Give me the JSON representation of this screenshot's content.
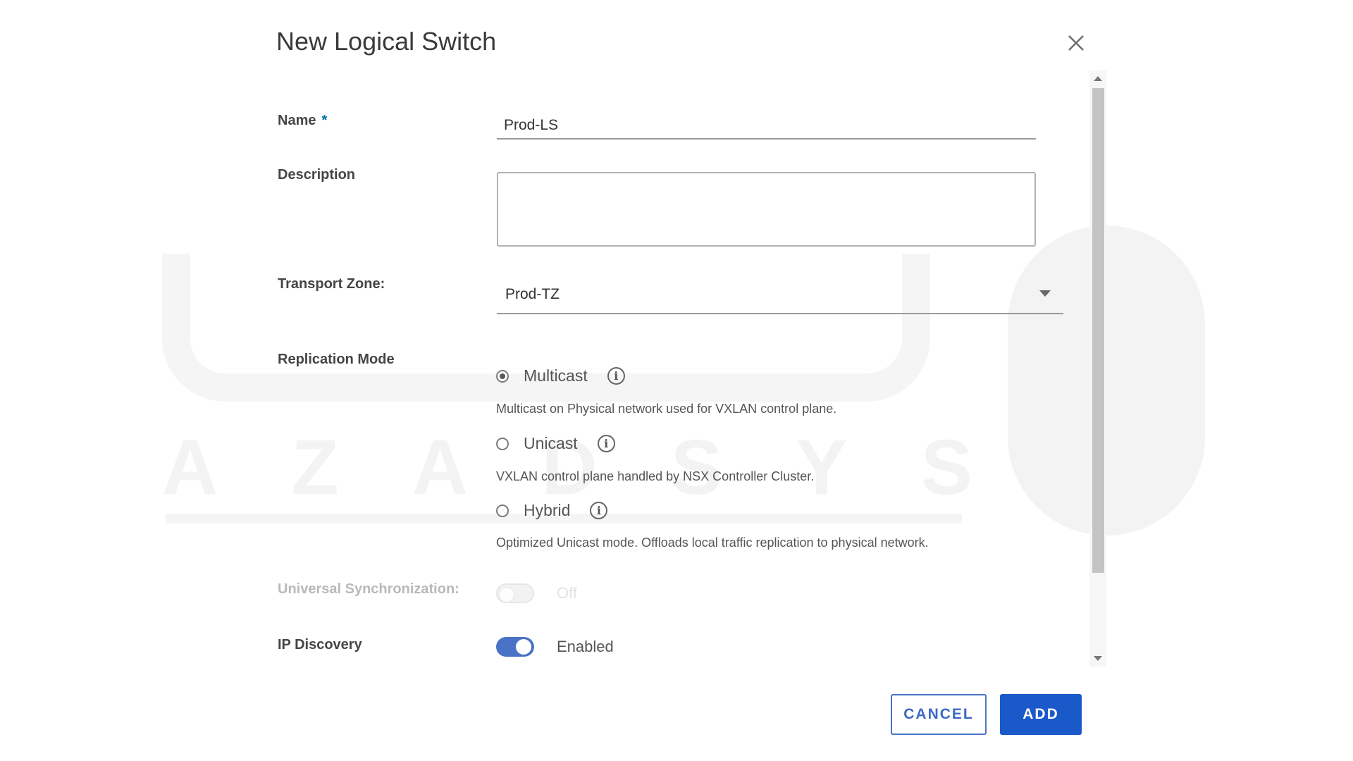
{
  "dialog": {
    "title": "New Logical Switch"
  },
  "form": {
    "name": {
      "label": "Name",
      "required_marker": "*",
      "value": "Prod-LS"
    },
    "description": {
      "label": "Description",
      "value": ""
    },
    "transport_zone": {
      "label": "Transport Zone:",
      "value": "Prod-TZ"
    },
    "replication_mode": {
      "label": "Replication Mode",
      "selected": "Multicast",
      "options": [
        {
          "label": "Multicast",
          "description": "Multicast on Physical network used for VXLAN control plane."
        },
        {
          "label": "Unicast",
          "description": "VXLAN control plane handled by NSX Controller Cluster."
        },
        {
          "label": "Hybrid",
          "description": "Optimized Unicast mode. Offloads local traffic replication to physical network."
        }
      ]
    },
    "universal_sync": {
      "label": "Universal Synchronization:",
      "state_text": "Off",
      "enabled": false
    },
    "ip_discovery": {
      "label": "IP Discovery",
      "state_text": "Enabled",
      "enabled": true
    }
  },
  "buttons": {
    "cancel": "CANCEL",
    "add": "ADD"
  },
  "watermark": {
    "letters": [
      "A",
      "Z",
      "A",
      "D",
      "S",
      "Y",
      "S"
    ]
  },
  "colors": {
    "primary": "#1a59c9",
    "toggle_on": "#4a73c8",
    "required": "#0072a3"
  }
}
